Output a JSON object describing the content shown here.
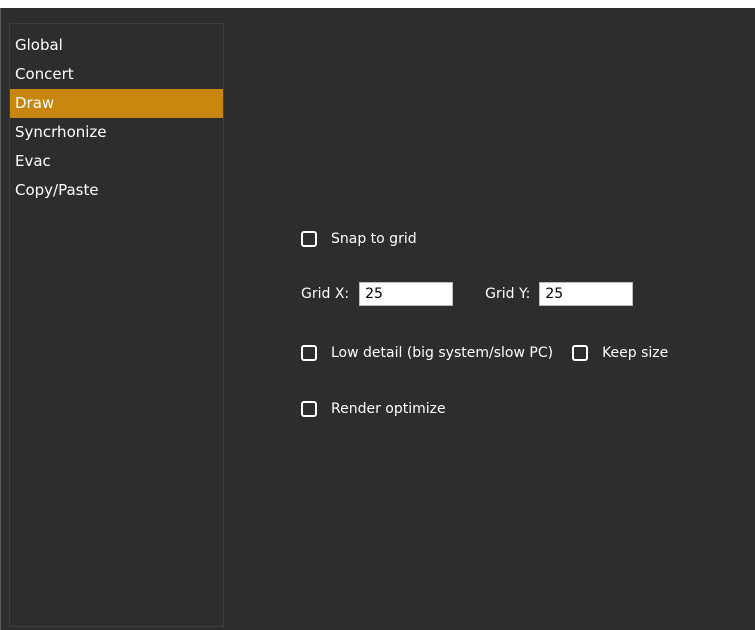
{
  "sidebar": {
    "items": [
      {
        "label": "Global"
      },
      {
        "label": "Concert"
      },
      {
        "label": "Draw",
        "selected": true
      },
      {
        "label": "Syncrhonize"
      },
      {
        "label": "Evac"
      },
      {
        "label": "Copy/Paste"
      }
    ]
  },
  "colors": {
    "background": "#2d2d2d",
    "accent_selected": "#c8860f",
    "text": "#ffffff"
  },
  "draw": {
    "snap_to_grid": {
      "label": "Snap to grid",
      "checked": false
    },
    "grid_x": {
      "label": "Grid X:",
      "value": "25"
    },
    "grid_y": {
      "label": "Grid Y:",
      "value": "25"
    },
    "low_detail": {
      "label": "Low detail (big system/slow PC)",
      "checked": false
    },
    "keep_size": {
      "label": "Keep size",
      "checked": false
    },
    "render_optimize": {
      "label": "Render optimize",
      "checked": false
    }
  },
  "icons": {
    "checkbox": "checkbox-unchecked-icon"
  }
}
